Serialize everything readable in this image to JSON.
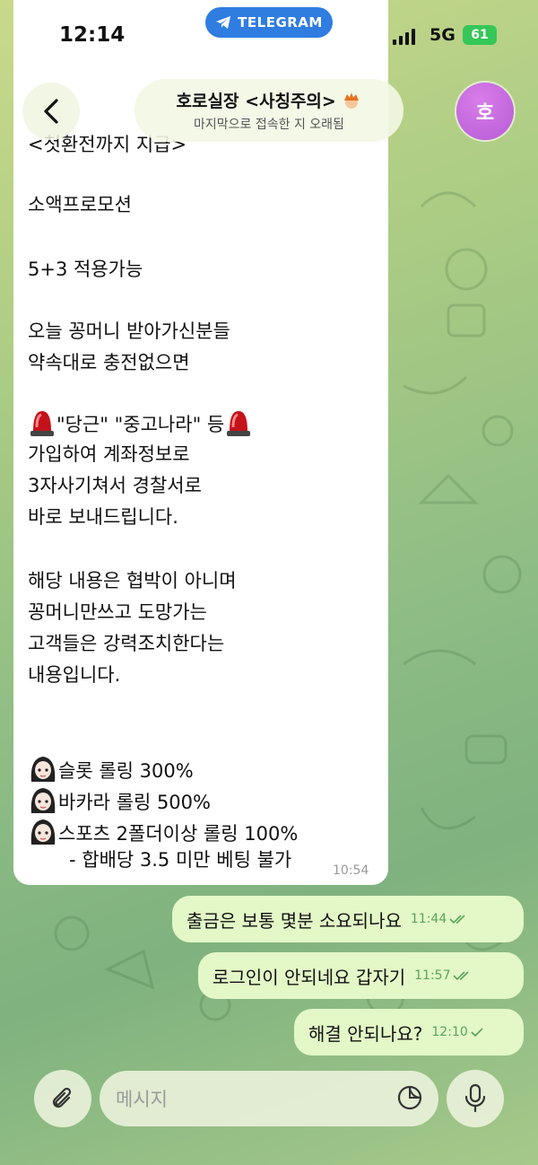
{
  "status_bar": {
    "time": "12:14",
    "app_pill": "TELEGRAM",
    "network": "5G",
    "battery": "61"
  },
  "header": {
    "title": "호로실장 <사칭주의>",
    "subtitle": "마지막으로 접속한 지 오래됨",
    "avatar_initial": "호"
  },
  "incoming": {
    "lines": [
      "<첫환전까지 지급>",
      "소액프로모션",
      "5+3 적용가능",
      "오늘 꽁머니 받아가신분들",
      "약속대로 충전없으면",
      "\"당근\" \"중고나라\" 등",
      "가입하여 계좌정보로",
      "3자사기쳐서 경찰서로",
      "바로 보내드립니다.",
      "해당 내용은 협박이 아니며",
      "꽁머니만쓰고 도망가는",
      "고객들은 강력조치한다는",
      "내용입니다.",
      "슬롯 롤링 300%",
      "바카라 롤링 500%",
      "스포츠 2폴더이상 롤링 100%",
      "- 합배당 3.5 미만 베팅 불가"
    ],
    "time": "10:54"
  },
  "outgoing": [
    {
      "text": "출금은 보통 몇분 소요되나요",
      "time": "11:44",
      "status": "read"
    },
    {
      "text": "로그인이 안되네요 갑자기",
      "time": "11:57",
      "status": "read"
    },
    {
      "text": "해결 안되나요?",
      "time": "12:10",
      "status": "sent"
    }
  ],
  "input": {
    "placeholder": "메시지"
  },
  "icons": {
    "back": "back-chevron-icon",
    "attach": "paperclip-icon",
    "sticker": "sticker-icon",
    "mic": "microphone-icon",
    "siren": "siren-emoji",
    "girl": "girl-sticker-emoji"
  },
  "colors": {
    "accent": "#2f7de1",
    "outgoing_bubble": "#e3f7c7",
    "checks": "#5aa55a",
    "avatar": "#c06ee0"
  }
}
